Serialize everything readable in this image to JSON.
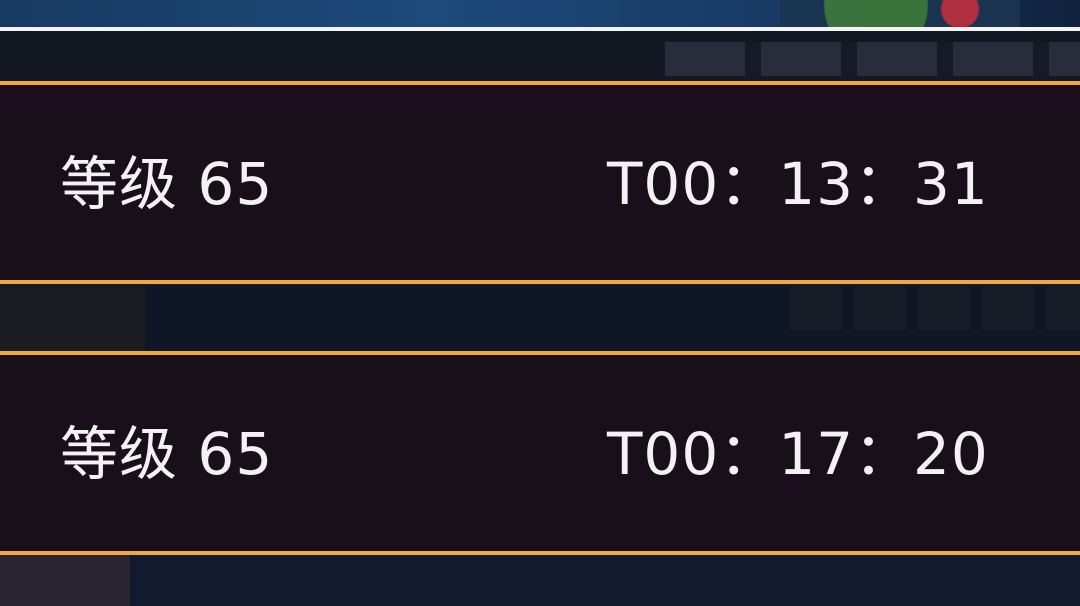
{
  "entries": [
    {
      "level": "等级 65",
      "time": "T00：13：31"
    },
    {
      "level": "等级 65",
      "time": "T00：17：20"
    }
  ],
  "colors": {
    "row_background": "#190f1a",
    "row_border": "#f2a93b",
    "text": "#f3f1f4",
    "top_line": "#f4f4f4"
  }
}
